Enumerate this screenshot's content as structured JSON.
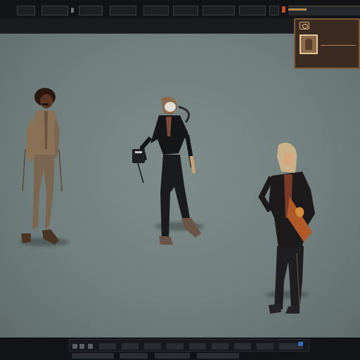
{
  "window": {
    "title": ""
  },
  "topbar": {
    "tabs": [
      {
        "id": "tab-1",
        "label": ""
      },
      {
        "id": "tab-2",
        "label": ""
      },
      {
        "id": "tab-3",
        "label": ""
      },
      {
        "id": "tab-4",
        "label": ""
      },
      {
        "id": "tab-5",
        "label": ""
      },
      {
        "id": "tab-6",
        "label": ""
      },
      {
        "id": "tab-7",
        "label": ""
      }
    ],
    "timeline_progress": 0.25
  },
  "toolbar": {
    "title": ""
  },
  "viewport": {
    "characters": [
      {
        "id": "character-left",
        "name": ""
      },
      {
        "id": "character-center",
        "name": ""
      },
      {
        "id": "character-right",
        "name": ""
      }
    ]
  },
  "inspector": {
    "name": "",
    "sub": ""
  },
  "bottombar": {
    "items": [
      "",
      "",
      "",
      "",
      "",
      "",
      "",
      "",
      ""
    ]
  },
  "colors": {
    "viewport_bg": "#71807e",
    "panel_bg": "#3a2a1f",
    "panel_border": "#7a5a3c",
    "accent_red": "#c44a2a",
    "accent_blue": "#3a6fb8"
  }
}
